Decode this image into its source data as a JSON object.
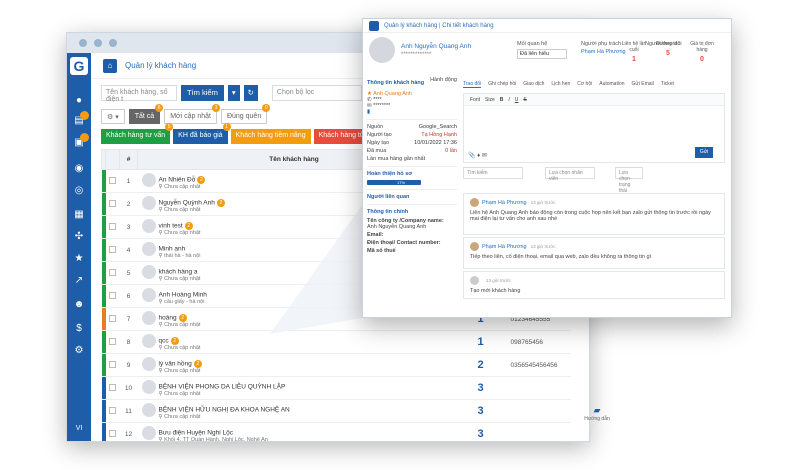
{
  "app": {
    "logo": "G",
    "window_dots": 3
  },
  "crumb": {
    "title": "Quản lý khách hàng"
  },
  "toolbar": {
    "search_placeholder": "Tên khách hàng, số điện t",
    "search_btn": "Tìm kiếm",
    "filter_placeholder": "Chọn bộ lọc"
  },
  "chips": [
    {
      "label": "Tất cả",
      "count": "6"
    },
    {
      "label": "Mới cập nhật",
      "count": "3"
    },
    {
      "label": "Đúng quên",
      "count": "0"
    }
  ],
  "tags": [
    {
      "label": "Khách hàng tư vấn",
      "count": "5",
      "color": "#1e9f43"
    },
    {
      "label": "KH đã báo giá",
      "count": "1",
      "color": "#1e5ea8"
    },
    {
      "label": "Khách hàng tiềm năng",
      "count": "",
      "color": "#f39c12"
    },
    {
      "label": "Khách hàng từ chối",
      "count": "",
      "color": "#e74c3c"
    }
  ],
  "table": {
    "col_num": "#",
    "col_name": "Tên khách hàng"
  },
  "rows": [
    {
      "n": "1",
      "name": "An Nhiên Đỗ",
      "badge": "2",
      "sub": "Chưa cập nhật",
      "color": "#1e9f43",
      "big": "",
      "phone": ""
    },
    {
      "n": "2",
      "name": "Nguyễn Quỳnh Anh",
      "badge": "2",
      "sub": "Chưa cập nhật",
      "color": "#1e9f43",
      "big": "",
      "phone": ""
    },
    {
      "n": "3",
      "name": "vinh test",
      "badge": "2",
      "sub": "Chưa cập nhật",
      "color": "#1e9f43",
      "big": "",
      "phone": ""
    },
    {
      "n": "4",
      "name": "Minh anh",
      "badge": "",
      "sub": "thái hà - hà nội",
      "color": "#1e9f43",
      "big": "",
      "phone": ""
    },
    {
      "n": "5",
      "name": "khách hàng a",
      "badge": "",
      "sub": "Chưa cập nhật",
      "color": "#1e9f43",
      "big": "",
      "phone": ""
    },
    {
      "n": "6",
      "name": "Anh Hoàng Minh",
      "badge": "",
      "sub": "cầu giấy - hà nội",
      "color": "#1e9f43",
      "big": "",
      "phone": ""
    },
    {
      "n": "7",
      "name": "hoàng",
      "badge": "2",
      "sub": "Chưa cập nhật",
      "color": "#e67e22",
      "big": "1",
      "phone": "01234645555"
    },
    {
      "n": "8",
      "name": "qcc",
      "badge": "2",
      "sub": "Chưa cập nhật",
      "color": "#1e9f43",
      "big": "1",
      "phone": "098765456"
    },
    {
      "n": "9",
      "name": "lý văn hồng",
      "badge": "2",
      "sub": "Chưa cập nhật",
      "color": "#1e9f43",
      "big": "2",
      "phone": "0356545456456"
    },
    {
      "n": "10",
      "name": "BỆNH VIỆN PHONG DA LIỄU QUỲNH LẬP",
      "badge": "",
      "sub": "Chưa cập nhật",
      "color": "#1e5ea8",
      "big": "3",
      "phone": ""
    },
    {
      "n": "11",
      "name": "BỆNH VIỆN HỮU NGHỊ ĐA KHOA NGHỆ AN",
      "badge": "",
      "sub": "Chưa cập nhật",
      "color": "#1e5ea8",
      "big": "3",
      "phone": ""
    },
    {
      "n": "12",
      "name": "Bưu điện Huyện Nghi Lộc",
      "badge": "",
      "sub": "Khối 4, TT Quán Hành, Nghi Lộc, Nghệ An",
      "color": "#1e5ea8",
      "big": "3",
      "phone": ""
    }
  ],
  "popup": {
    "breadcrumb": "Quản lý khách hàng | Chi tiết khách hàng",
    "name": "Anh Nguyễn Quang Anh",
    "subname": "*************",
    "meta": [
      {
        "label": "Mối quan hệ",
        "value": "Đã liên hiểu"
      },
      {
        "label": "Người phụ trách",
        "value": "Phạm Hà Phương"
      },
      {
        "label": "Người theo dõi",
        "value": ""
      }
    ],
    "stats": [
      {
        "label": "Liên hệ lần cuối",
        "value": "1"
      },
      {
        "label": "Đường tác",
        "value": "5"
      },
      {
        "label": "Giá trị đơn hàng",
        "value": "0"
      }
    ],
    "left": {
      "title": "Thông tin khách hàng",
      "action": "Hành động",
      "contact": "Anh Quang Anh",
      "rows": [
        {
          "k": "Nguồn",
          "v": "Google_Search"
        },
        {
          "k": "Người tạo",
          "v": "Tạ Hồng Hạnh"
        },
        {
          "k": "Ngày tạo",
          "v": "10/01/2022 17:36"
        },
        {
          "k": "Đã mua",
          "v": "0 lần"
        }
      ],
      "last": "Lần mua hàng gần nhất",
      "progress_label": "Hoàn thiện hồ sơ",
      "progress": "17%",
      "related": "Người liên quan",
      "detail": "Thông tin chính",
      "company_label": "Tên công ty /Company name:",
      "company": "Anh Nguyễn Quang Anh",
      "email": "Email:",
      "phone": "Điện thoại/ Contact number:",
      "tax": "Mã số thuế"
    },
    "tabs": [
      "Trao đổi",
      "Ghi chép hồi",
      "Giao dịch",
      "Lịch hẹn",
      "Cơ hội",
      "Automation",
      "Gửi Email",
      "Ticket"
    ],
    "editor_tools": [
      "Font",
      "Size",
      "B",
      "I",
      "U",
      "S"
    ],
    "send": "Gửi",
    "filters": [
      "Tìm kiếm",
      "Lựa chọn nhân viên",
      "Lựa chọn trạng thái"
    ],
    "comments": [
      {
        "who": "Phạm Hà Phương",
        "time": "13 giờ trước",
        "text": "Liên hệ Anh Quang Anh báo động còn trong cuộc họp nên kết bạn zalo gửi thông tin trước rồi ngày mai điện lại tư vấn cho anh sau nhé"
      },
      {
        "who": "Phạm Hà Phương",
        "time": "13 giờ trước",
        "text": "Tiếp theo liên, cố điện thoại, email qua web, zalo đều không ra thông tin gì"
      },
      {
        "who": "",
        "time": "13 giờ trước",
        "text": "Tạo mới khách hàng"
      }
    ]
  },
  "help": "Hướng dẫn"
}
